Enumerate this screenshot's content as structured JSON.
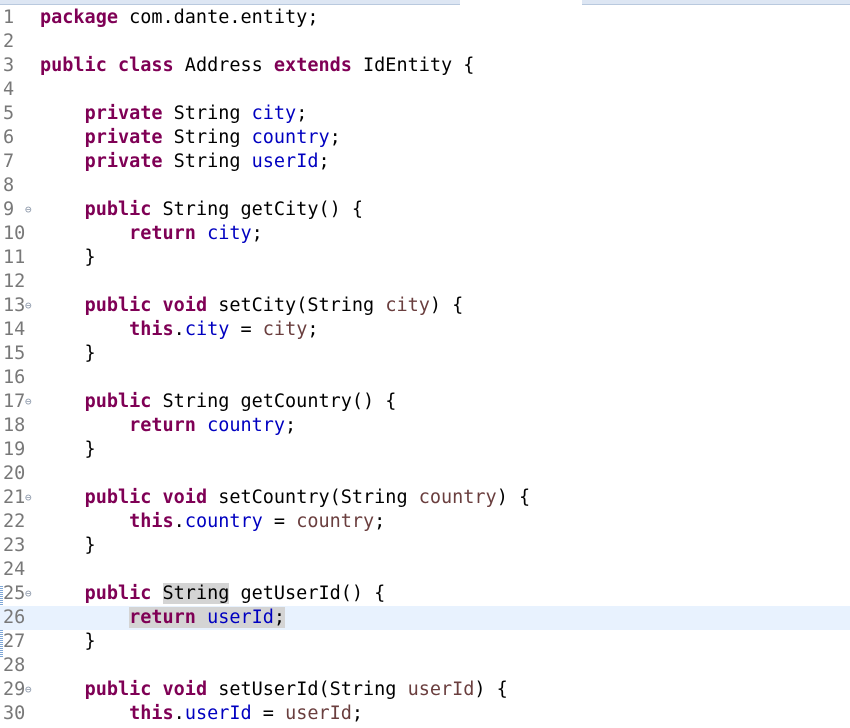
{
  "editor": {
    "lines": [
      {
        "n": "1",
        "fold": "",
        "tokens": [
          {
            "t": "package",
            "c": "kw"
          },
          {
            "t": " com.dante.entity;"
          }
        ]
      },
      {
        "n": "2",
        "fold": "",
        "tokens": []
      },
      {
        "n": "3",
        "fold": "",
        "tokens": [
          {
            "t": "public",
            "c": "kw"
          },
          {
            "t": " "
          },
          {
            "t": "class",
            "c": "kw"
          },
          {
            "t": " Address "
          },
          {
            "t": "extends",
            "c": "kw"
          },
          {
            "t": " IdEntity {"
          }
        ]
      },
      {
        "n": "4",
        "fold": "",
        "tokens": []
      },
      {
        "n": "5",
        "fold": "",
        "tokens": [
          {
            "t": "    "
          },
          {
            "t": "private",
            "c": "kw"
          },
          {
            "t": " String "
          },
          {
            "t": "city",
            "c": "fld"
          },
          {
            "t": ";"
          }
        ]
      },
      {
        "n": "6",
        "fold": "",
        "tokens": [
          {
            "t": "    "
          },
          {
            "t": "private",
            "c": "kw"
          },
          {
            "t": " String "
          },
          {
            "t": "country",
            "c": "fld"
          },
          {
            "t": ";"
          }
        ]
      },
      {
        "n": "7",
        "fold": "",
        "tokens": [
          {
            "t": "    "
          },
          {
            "t": "private",
            "c": "kw"
          },
          {
            "t": " String "
          },
          {
            "t": "userId",
            "c": "fld"
          },
          {
            "t": ";"
          }
        ]
      },
      {
        "n": "8",
        "fold": "",
        "tokens": []
      },
      {
        "n": "9",
        "fold": "⊖",
        "tokens": [
          {
            "t": "    "
          },
          {
            "t": "public",
            "c": "kw"
          },
          {
            "t": " String getCity() {"
          }
        ]
      },
      {
        "n": "10",
        "fold": "",
        "tokens": [
          {
            "t": "        "
          },
          {
            "t": "return",
            "c": "kw"
          },
          {
            "t": " "
          },
          {
            "t": "city",
            "c": "fld"
          },
          {
            "t": ";"
          }
        ]
      },
      {
        "n": "11",
        "fold": "",
        "tokens": [
          {
            "t": "    }"
          }
        ]
      },
      {
        "n": "12",
        "fold": "",
        "tokens": []
      },
      {
        "n": "13",
        "fold": "⊖",
        "tokens": [
          {
            "t": "    "
          },
          {
            "t": "public",
            "c": "kw"
          },
          {
            "t": " "
          },
          {
            "t": "void",
            "c": "kw"
          },
          {
            "t": " setCity(String "
          },
          {
            "t": "city",
            "c": "par"
          },
          {
            "t": ") {"
          }
        ]
      },
      {
        "n": "14",
        "fold": "",
        "tokens": [
          {
            "t": "        "
          },
          {
            "t": "this",
            "c": "kw"
          },
          {
            "t": "."
          },
          {
            "t": "city",
            "c": "fld"
          },
          {
            "t": " = "
          },
          {
            "t": "city",
            "c": "par"
          },
          {
            "t": ";"
          }
        ]
      },
      {
        "n": "15",
        "fold": "",
        "tokens": [
          {
            "t": "    }"
          }
        ]
      },
      {
        "n": "16",
        "fold": "",
        "tokens": []
      },
      {
        "n": "17",
        "fold": "⊖",
        "tokens": [
          {
            "t": "    "
          },
          {
            "t": "public",
            "c": "kw"
          },
          {
            "t": " String getCountry() {"
          }
        ]
      },
      {
        "n": "18",
        "fold": "",
        "tokens": [
          {
            "t": "        "
          },
          {
            "t": "return",
            "c": "kw"
          },
          {
            "t": " "
          },
          {
            "t": "country",
            "c": "fld"
          },
          {
            "t": ";"
          }
        ]
      },
      {
        "n": "19",
        "fold": "",
        "tokens": [
          {
            "t": "    }"
          }
        ]
      },
      {
        "n": "20",
        "fold": "",
        "tokens": []
      },
      {
        "n": "21",
        "fold": "⊖",
        "tokens": [
          {
            "t": "    "
          },
          {
            "t": "public",
            "c": "kw"
          },
          {
            "t": " "
          },
          {
            "t": "void",
            "c": "kw"
          },
          {
            "t": " setCountry(String "
          },
          {
            "t": "country",
            "c": "par"
          },
          {
            "t": ") {"
          }
        ]
      },
      {
        "n": "22",
        "fold": "",
        "tokens": [
          {
            "t": "        "
          },
          {
            "t": "this",
            "c": "kw"
          },
          {
            "t": "."
          },
          {
            "t": "country",
            "c": "fld"
          },
          {
            "t": " = "
          },
          {
            "t": "country",
            "c": "par"
          },
          {
            "t": ";"
          }
        ]
      },
      {
        "n": "23",
        "fold": "",
        "tokens": [
          {
            "t": "    }"
          }
        ]
      },
      {
        "n": "24",
        "fold": "",
        "tokens": []
      },
      {
        "n": "25",
        "fold": "⊖",
        "tokens": [
          {
            "t": "    "
          },
          {
            "t": "public",
            "c": "kw"
          },
          {
            "t": " "
          },
          {
            "t": "String",
            "c": "sel"
          },
          {
            "t": " getUserId() {"
          }
        ]
      },
      {
        "n": "26",
        "fold": "",
        "current": true,
        "tokens": [
          {
            "t": "        "
          },
          {
            "t": "return",
            "c": "kw sel"
          },
          {
            "t": " ",
            "c": "sel"
          },
          {
            "t": "userId",
            "c": "fld sel"
          },
          {
            "t": ";",
            "c": "sel"
          }
        ]
      },
      {
        "n": "27",
        "fold": "",
        "tokens": [
          {
            "t": "    }"
          }
        ]
      },
      {
        "n": "28",
        "fold": "",
        "tokens": []
      },
      {
        "n": "29",
        "fold": "⊖",
        "tokens": [
          {
            "t": "    "
          },
          {
            "t": "public",
            "c": "kw"
          },
          {
            "t": " "
          },
          {
            "t": "void",
            "c": "kw"
          },
          {
            "t": " setUserId(String "
          },
          {
            "t": "userId",
            "c": "par"
          },
          {
            "t": ") {"
          }
        ]
      },
      {
        "n": "30",
        "fold": "",
        "tokens": [
          {
            "t": "        "
          },
          {
            "t": "this",
            "c": "kw"
          },
          {
            "t": "."
          },
          {
            "t": "userId",
            "c": "fld"
          },
          {
            "t": " = "
          },
          {
            "t": "userId",
            "c": "par"
          },
          {
            "t": ";"
          }
        ]
      }
    ]
  },
  "colors": {
    "keyword": "#7f0055",
    "field": "#0000c0",
    "parameter": "#6a3e3e",
    "line_number": "#787878",
    "current_line": "#e8f2fe",
    "occurrence": "#d4d4d4"
  }
}
